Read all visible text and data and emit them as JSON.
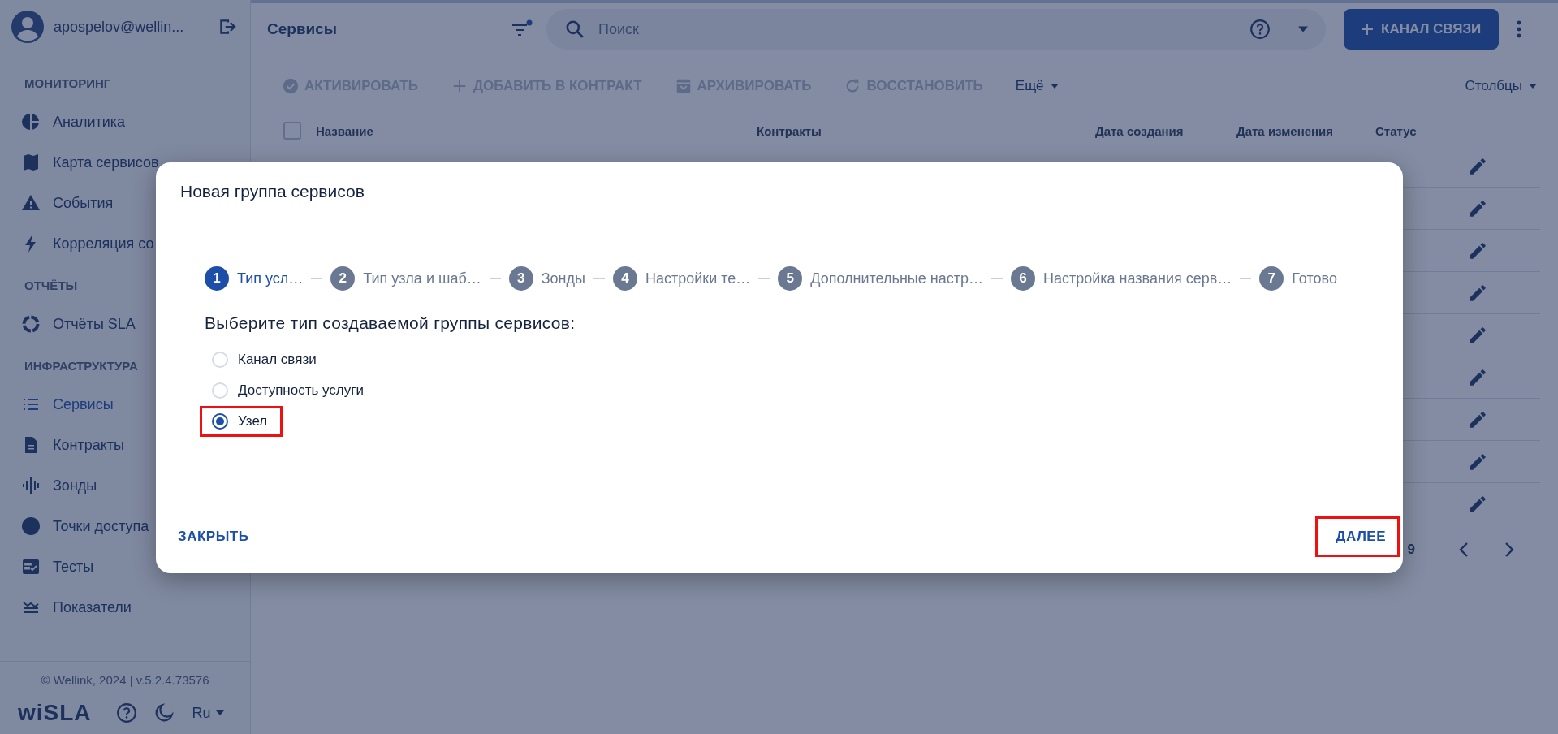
{
  "user": {
    "name": "apospelov@wellin..."
  },
  "sidebar": {
    "sections": [
      {
        "title": "МОНИТОРИНГ",
        "items": [
          {
            "label": "Аналитика",
            "selected": false
          },
          {
            "label": "Карта сервисов",
            "selected": false
          },
          {
            "label": "События",
            "selected": false
          },
          {
            "label": "Корреляция со",
            "selected": false
          }
        ]
      },
      {
        "title": "ОТЧЁТЫ",
        "items": [
          {
            "label": "Отчёты SLA",
            "selected": false
          }
        ]
      },
      {
        "title": "ИНФРАСТРУКТУРА",
        "items": [
          {
            "label": "Сервисы",
            "selected": true
          },
          {
            "label": "Контракты",
            "selected": false
          },
          {
            "label": "Зонды",
            "selected": false
          },
          {
            "label": "Точки доступа",
            "selected": false
          },
          {
            "label": "Тесты",
            "selected": false
          },
          {
            "label": "Показатели",
            "selected": false
          }
        ]
      }
    ],
    "footer": {
      "copyright": "© Wellink, 2024 | v.5.2.4.73576",
      "logo": "wiSLA",
      "language": "Ru"
    }
  },
  "header": {
    "title": "Сервисы",
    "search": {
      "placeholder": "Поиск"
    },
    "primary_button": "КАНАЛ СВЯЗИ"
  },
  "toolbar": {
    "actions": [
      {
        "label": "АКТИВИРОВАТЬ",
        "disabled": true
      },
      {
        "label": "ДОБАВИТЬ В КОНТРАКТ",
        "disabled": true
      },
      {
        "label": "АРХИВИРОВАТЬ",
        "disabled": true
      },
      {
        "label": "ВОССТАНОВИТЬ",
        "disabled": true
      }
    ],
    "more": "Ещё",
    "columns": "Столбцы"
  },
  "table": {
    "columns": [
      "Название",
      "Контракты",
      "Дата создания",
      "Дата изменения",
      "Статус"
    ],
    "select_all": {
      "checked": false
    },
    "pagination": "9"
  },
  "dialog": {
    "title": "Новая группа сервисов",
    "steps": [
      {
        "number": "1",
        "label": "Тип усл…",
        "selected": true
      },
      {
        "number": "2",
        "label": "Тип узла и шаб…",
        "selected": false
      },
      {
        "number": "3",
        "label": "Зонды",
        "selected": false
      },
      {
        "number": "4",
        "label": "Настройки те…",
        "selected": false
      },
      {
        "number": "5",
        "label": "Дополнительные настр…",
        "selected": false
      },
      {
        "number": "6",
        "label": "Настройка названия серв…",
        "selected": false
      },
      {
        "number": "7",
        "label": "Готово",
        "selected": false
      }
    ],
    "question": "Выберите тип создаваемой группы сервисов:",
    "options": [
      {
        "label": "Канал связи",
        "selected": false,
        "highlighted": false
      },
      {
        "label": "Доступность услуги",
        "selected": false,
        "highlighted": false
      },
      {
        "label": "Узел",
        "selected": true,
        "highlighted": true
      }
    ],
    "close_button": {
      "label": "ЗАКРЫТЬ",
      "highlighted": false
    },
    "next_button": {
      "label": "ДАЛЕЕ",
      "highlighted": true
    }
  }
}
